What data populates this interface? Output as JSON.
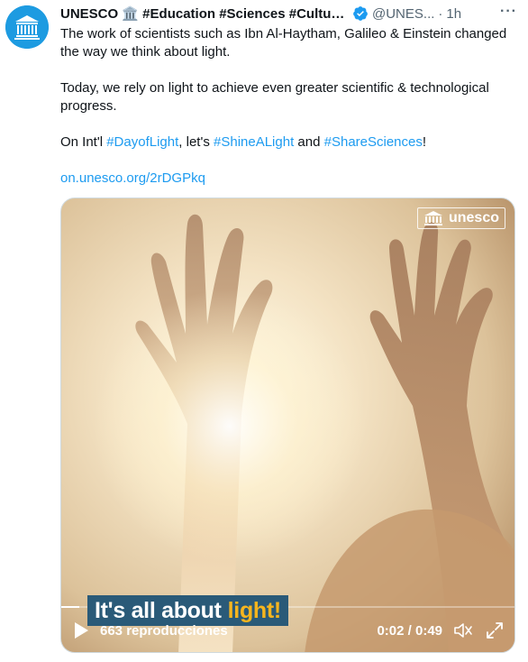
{
  "tweet": {
    "display_name": "UNESCO 🏛️ #Education #Sciences #Culture ...",
    "handle": "@UNES...",
    "separator": "·",
    "time": "1h",
    "more": "···",
    "text": {
      "line1": "The work of scientists such as Ibn Al-Haytham, Galileo & Einstein changed the way we think about light.",
      "line2": "Today, we rely on light to achieve even greater scientific & technological progress.",
      "line3_prefix": "On Int'l ",
      "hashtag1": "#DayofLight",
      "line3_mid": ", let's ",
      "hashtag2": "#ShineALight",
      "line3_and": " and ",
      "hashtag3": "#ShareSciences",
      "line3_end": "!",
      "link": "on.unesco.org/2rDGPkq"
    }
  },
  "video": {
    "watermark": "unesco",
    "caption_main": "It's all about",
    "caption_highlight": "light!",
    "views": "663 reproducciones",
    "timecode": "0:02 / 0:49",
    "progress": 0.04
  },
  "icons": {
    "avatar": "unesco-temple-logo",
    "verified": "verified-badge-icon",
    "play": "play-icon",
    "volume": "volume-icon",
    "fullscreen": "fullscreen-icon"
  },
  "colors": {
    "accent": "#1d9bf0",
    "avatar_bg": "#1d9be1",
    "caption_bg": "#2a5a78",
    "caption_highlight": "#f6b51e"
  }
}
